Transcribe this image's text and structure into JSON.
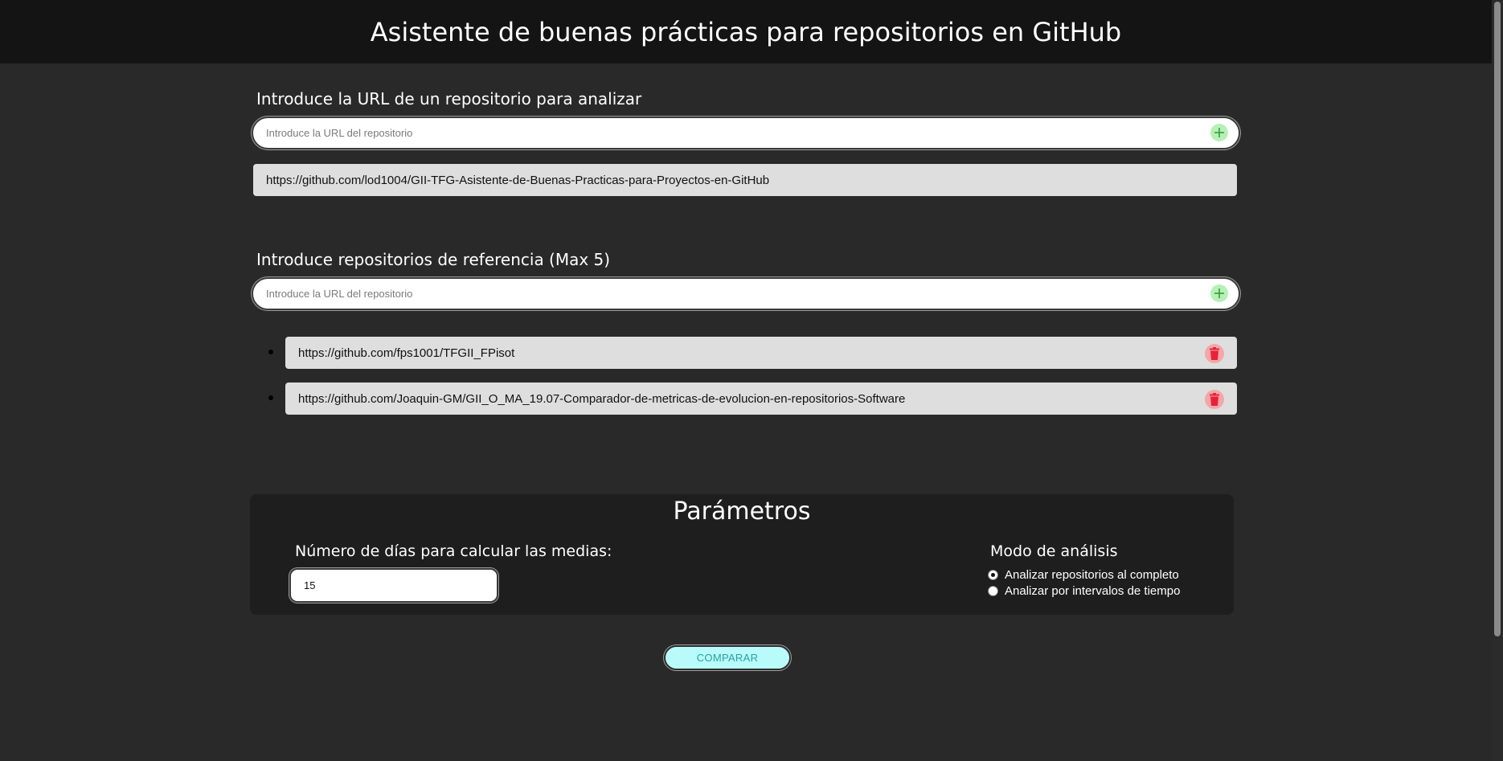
{
  "header": {
    "title": "Asistente de buenas prácticas para repositorios en GitHub"
  },
  "analyze": {
    "title": "Introduce la URL de un repositorio para analizar",
    "input": {
      "placeholder": "Introduce la URL del repositorio",
      "value": ""
    },
    "add_icon": "plus-circle-icon",
    "selected_repo": "https://github.com/lod1004/GII-TFG-Asistente-de-Buenas-Practicas-para-Proyectos-en-GitHub"
  },
  "references": {
    "title": "Introduce repositorios de referencia (Max 5)",
    "input": {
      "placeholder": "Introduce la URL del repositorio",
      "value": ""
    },
    "add_icon": "plus-circle-icon",
    "delete_icon": "trash-icon",
    "items": [
      {
        "url": "https://github.com/fps1001/TFGII_FPisot"
      },
      {
        "url": "https://github.com/Joaquin-GM/GII_O_MA_19.07-Comparador-de-metricas-de-evolucion-en-repositorios-Software"
      }
    ]
  },
  "parameters": {
    "title": "Parámetros",
    "days_label": "Número de días para calcular las medias:",
    "days_value": "15",
    "mode_label": "Modo de análisis",
    "modes": [
      {
        "label": "Analizar repositorios al completo",
        "checked": true
      },
      {
        "label": "Analizar por intervalos de tiempo",
        "checked": false
      }
    ]
  },
  "compare_button": {
    "label": "COMPARAR"
  },
  "colors": {
    "background": "#292929",
    "header": "#141414",
    "panel": "#1e1e1e",
    "add": "#b6f0b6",
    "delete": "#f3a7a7",
    "compare": "#b9fbfb"
  }
}
